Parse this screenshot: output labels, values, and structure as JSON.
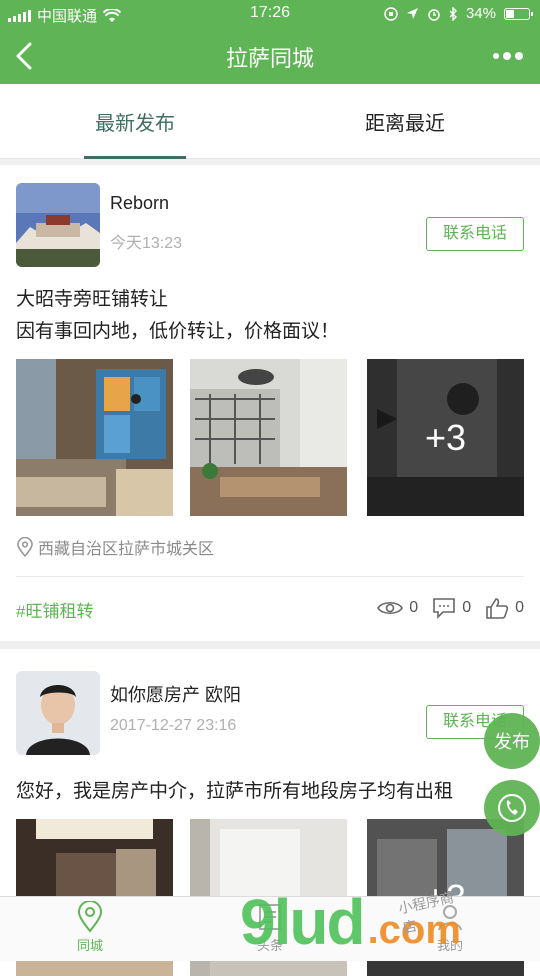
{
  "status": {
    "carrier": "中国联通",
    "time": "17:26",
    "battery": "34%",
    "battery_level": 0.34
  },
  "navbar": {
    "title": "拉萨同城"
  },
  "tabs": [
    {
      "label": "最新发布",
      "active": true
    },
    {
      "label": "距离最近",
      "active": false
    }
  ],
  "posts": [
    {
      "user": "Reborn",
      "time": "今天13:23",
      "call": "联系电话",
      "title": "大昭寺旁旺铺转让",
      "body": "因有事回内地，低价转让，价格面议！",
      "more_images": "+3",
      "location": "西藏自治区拉萨市城关区",
      "tag": "#旺铺租转",
      "views": "0",
      "comments": "0",
      "likes": "0"
    },
    {
      "user": "如你愿房产 欧阳",
      "time": "2017-12-27 23:16",
      "call": "联系电话",
      "body": "您好，我是房产中介，拉萨市所有地段房子均有出租",
      "more_images": "+3"
    }
  ],
  "fab": {
    "publish": "发布"
  },
  "bottom": [
    {
      "label": "同城",
      "icon": "location-icon",
      "active": true
    },
    {
      "label": "头条",
      "icon": "news-icon",
      "active": false
    },
    {
      "label": "我的",
      "icon": "user-icon",
      "active": false
    }
  ],
  "watermark": {
    "main": "9lud",
    "suffix": ".com",
    "small": "小程序商店"
  },
  "colors": {
    "brand": "#5fb455",
    "tab_active": "#3f6e62",
    "watermark_green": "#4fc25a",
    "watermark_orange": "#f08a24"
  }
}
